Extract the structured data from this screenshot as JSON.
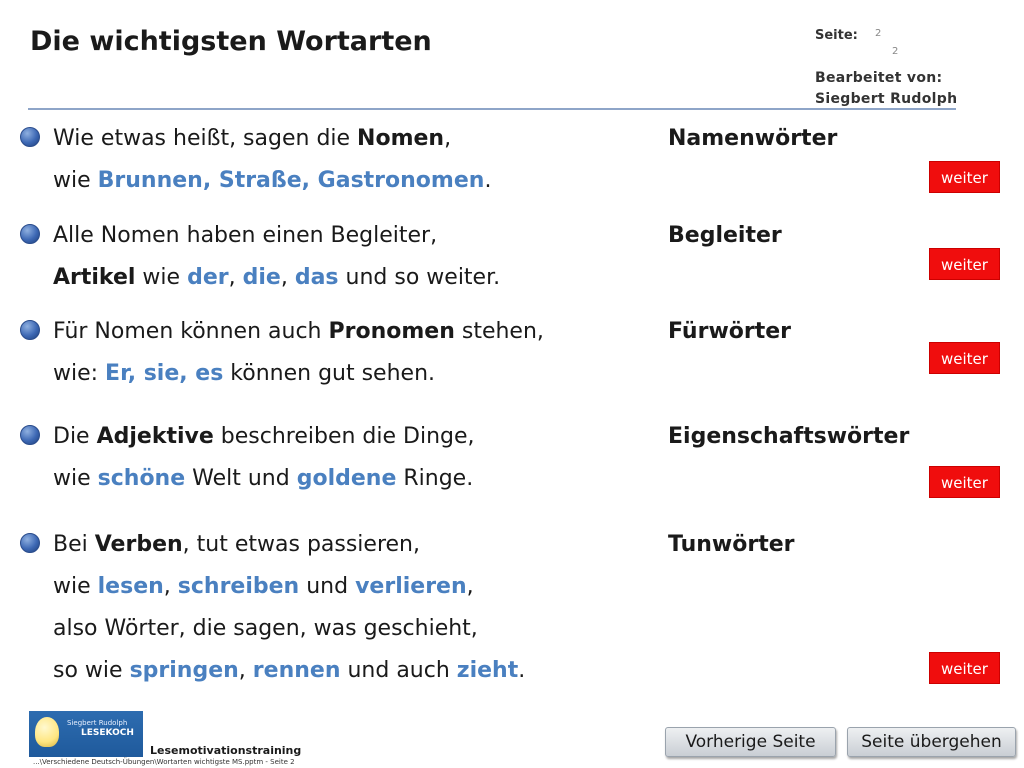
{
  "page": {
    "title": "Die wichtigsten Wortarten",
    "seite_label": "Seite:",
    "page_current": "2",
    "page_total": "2",
    "edited_by_label": "Bearbeitet von:",
    "edited_by_name": "Siegbert Rudolph"
  },
  "sections": [
    {
      "term": "Namenwörter",
      "l1": {
        "a": "Wie etwas heißt, sagen die ",
        "b": "Nomen",
        "c": ","
      },
      "l2": {
        "a": "wie ",
        "b": "Brunnen, Straße, Gastronomen",
        "c": "."
      },
      "button": "weiter"
    },
    {
      "term": "Begleiter",
      "l1": {
        "a": "Alle Nomen haben einen Begleiter,"
      },
      "l2": {
        "a": "Artikel",
        "b": " wie ",
        "c": "der",
        "d": ", ",
        "e": "die",
        "f": ", ",
        "g": "das",
        "h": " und so weiter."
      },
      "button": "weiter"
    },
    {
      "term": "Fürwörter",
      "l1": {
        "a": "Für Nomen können auch ",
        "b": "Pronomen",
        "c": " stehen,"
      },
      "l2": {
        "a": "wie: ",
        "b": "Er, sie, es",
        "c": " können gut sehen."
      },
      "button": "weiter"
    },
    {
      "term": "Eigenschaftswörter",
      "l1": {
        "a": "Die ",
        "b": "Adjektive",
        "c": " beschreiben die Dinge,"
      },
      "l2": {
        "a": "wie ",
        "b": "schöne",
        "c": " Welt und ",
        "d": "goldene",
        "e": " Ringe."
      },
      "button": "weiter"
    },
    {
      "term": "Tunwörter",
      "l1": {
        "a": "Bei ",
        "b": "Verben",
        "c": ", tut etwas passieren,"
      },
      "l2": {
        "a": "wie ",
        "b": "lesen",
        "c": ", ",
        "d": "schreiben",
        "e": " und ",
        "f": "verlieren",
        "g": ","
      },
      "l3": {
        "a": "also Wörter, die sagen, was geschieht,"
      },
      "l4": {
        "a": "so wie ",
        "b": "springen",
        "c": ", ",
        "d": "rennen",
        "e": " und auch ",
        "f": "zieht",
        "g": "."
      },
      "button": "weiter"
    }
  ],
  "footer": {
    "logo_line1": "Siegbert Rudolph",
    "logo_line2": "LESEKOCH",
    "title": "Lesemotivationstraining",
    "path": "...\\Verschiedene Deutsch-Übungen\\Wortarten wichtigste MS.pptm - Seite 2",
    "prev_button": "Vorherige Seite",
    "skip_button": "Seite übergehen"
  },
  "colors": {
    "accent_blue": "#4a80c0",
    "button_red": "#f00d0d",
    "rule": "#8ea5c8"
  }
}
